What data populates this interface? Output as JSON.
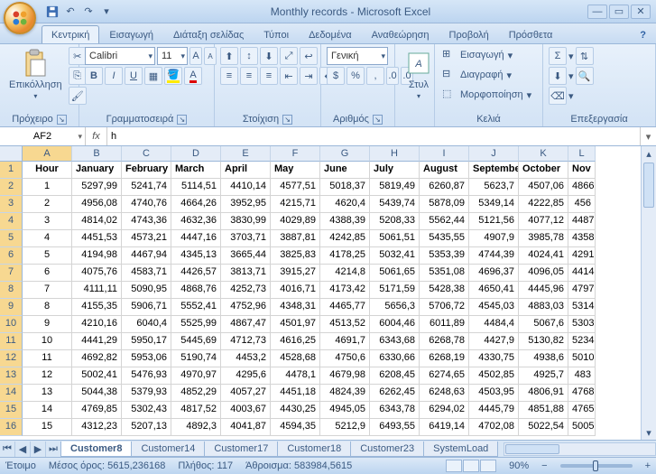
{
  "title": "Monthly records - Microsoft Excel",
  "tabs": [
    "Κεντρική",
    "Εισαγωγή",
    "Διάταξη σελίδας",
    "Τύποι",
    "Δεδομένα",
    "Αναθεώρηση",
    "Προβολή",
    "Πρόσθετα"
  ],
  "active_tab": 0,
  "ribbon": {
    "clipboard": {
      "paste": "Επικόλληση",
      "label": "Πρόχειρο"
    },
    "font": {
      "name": "Calibri",
      "size": "11",
      "label": "Γραμματοσειρά"
    },
    "alignment": {
      "label": "Στοίχιση"
    },
    "number": {
      "format": "Γενική",
      "label": "Αριθμός"
    },
    "styles": {
      "label": "Στυλ"
    },
    "cells": {
      "insert": "Εισαγωγή",
      "delete": "Διαγραφή",
      "format": "Μορφοποίηση",
      "label": "Κελιά"
    },
    "editing": {
      "label": "Επεξεργασία"
    }
  },
  "namebox": "AF2",
  "formula": "h",
  "col_letters": [
    "A",
    "B",
    "C",
    "D",
    "E",
    "F",
    "G",
    "H",
    "I",
    "J",
    "K",
    "L"
  ],
  "headers": [
    "Hour",
    "January",
    "February",
    "March",
    "April",
    "May",
    "June",
    "July",
    "August",
    "September",
    "October",
    "Nov"
  ],
  "rows": [
    {
      "n": 2,
      "v": [
        "1",
        "5297,99",
        "5241,74",
        "5114,51",
        "4410,14",
        "4577,51",
        "5018,37",
        "5819,49",
        "6260,87",
        "5623,7",
        "4507,06",
        "4866"
      ]
    },
    {
      "n": 3,
      "v": [
        "2",
        "4956,08",
        "4740,76",
        "4664,26",
        "3952,95",
        "4215,71",
        "4620,4",
        "5439,74",
        "5878,09",
        "5349,14",
        "4222,85",
        "456"
      ]
    },
    {
      "n": 4,
      "v": [
        "3",
        "4814,02",
        "4743,36",
        "4632,36",
        "3830,99",
        "4029,89",
        "4388,39",
        "5208,33",
        "5562,44",
        "5121,56",
        "4077,12",
        "4487"
      ]
    },
    {
      "n": 5,
      "v": [
        "4",
        "4451,53",
        "4573,21",
        "4447,16",
        "3703,71",
        "3887,81",
        "4242,85",
        "5061,51",
        "5435,55",
        "4907,9",
        "3985,78",
        "4358"
      ]
    },
    {
      "n": 6,
      "v": [
        "5",
        "4194,98",
        "4467,94",
        "4345,13",
        "3665,44",
        "3825,83",
        "4178,25",
        "5032,41",
        "5353,39",
        "4744,39",
        "4024,41",
        "4291"
      ]
    },
    {
      "n": 7,
      "v": [
        "6",
        "4075,76",
        "4583,71",
        "4426,57",
        "3813,71",
        "3915,27",
        "4214,8",
        "5061,65",
        "5351,08",
        "4696,37",
        "4096,05",
        "4414"
      ]
    },
    {
      "n": 8,
      "v": [
        "7",
        "4111,11",
        "5090,95",
        "4868,76",
        "4252,73",
        "4016,71",
        "4173,42",
        "5171,59",
        "5428,38",
        "4650,41",
        "4445,96",
        "4797"
      ]
    },
    {
      "n": 9,
      "v": [
        "8",
        "4155,35",
        "5906,71",
        "5552,41",
        "4752,96",
        "4348,31",
        "4465,77",
        "5656,3",
        "5706,72",
        "4545,03",
        "4883,03",
        "5314"
      ]
    },
    {
      "n": 10,
      "v": [
        "9",
        "4210,16",
        "6040,4",
        "5525,99",
        "4867,47",
        "4501,97",
        "4513,52",
        "6004,46",
        "6011,89",
        "4484,4",
        "5067,6",
        "5303"
      ]
    },
    {
      "n": 11,
      "v": [
        "10",
        "4441,29",
        "5950,17",
        "5445,69",
        "4712,73",
        "4616,25",
        "4691,7",
        "6343,68",
        "6268,78",
        "4427,9",
        "5130,82",
        "5234"
      ]
    },
    {
      "n": 12,
      "v": [
        "11",
        "4692,82",
        "5953,06",
        "5190,74",
        "4453,2",
        "4528,68",
        "4750,6",
        "6330,66",
        "6268,19",
        "4330,75",
        "4938,6",
        "5010"
      ]
    },
    {
      "n": 13,
      "v": [
        "12",
        "5002,41",
        "5476,93",
        "4970,97",
        "4295,6",
        "4478,1",
        "4679,98",
        "6208,45",
        "6274,65",
        "4502,85",
        "4925,7",
        "483"
      ]
    },
    {
      "n": 14,
      "v": [
        "13",
        "5044,38",
        "5379,93",
        "4852,29",
        "4057,27",
        "4451,18",
        "4824,39",
        "6262,45",
        "6248,63",
        "4503,95",
        "4806,91",
        "4768"
      ]
    },
    {
      "n": 15,
      "v": [
        "14",
        "4769,85",
        "5302,43",
        "4817,52",
        "4003,67",
        "4430,25",
        "4945,05",
        "6343,78",
        "6294,02",
        "4445,79",
        "4851,88",
        "4765"
      ]
    },
    {
      "n": 16,
      "v": [
        "15",
        "4312,23",
        "5207,13",
        "4892,3",
        "4041,87",
        "4594,35",
        "5212,9",
        "6493,55",
        "6419,14",
        "4702,08",
        "5022,54",
        "5005"
      ]
    }
  ],
  "sheet_tabs": [
    "Customer8",
    "Customer14",
    "Customer17",
    "Customer18",
    "Customer23",
    "SystemLoad"
  ],
  "active_sheet": 0,
  "status": {
    "ready": "Έτοιμο",
    "avg_label": "Μέσος όρος:",
    "avg_val": "5615,236168",
    "count_label": "Πλήθος:",
    "count_val": "117",
    "sum_label": "Άθροισμα:",
    "sum_val": "583984,5615",
    "zoom": "90%"
  }
}
